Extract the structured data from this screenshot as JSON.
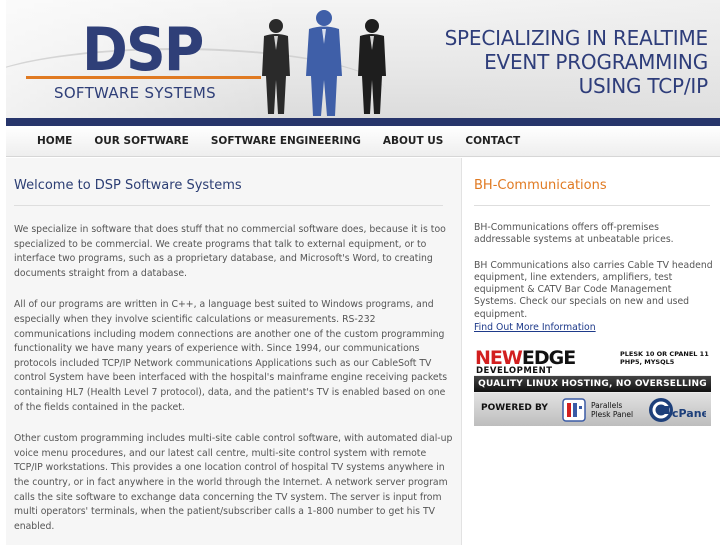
{
  "header": {
    "logo_main": "DSP",
    "logo_sub": "SOFTWARE SYSTEMS",
    "tagline": [
      "SPECIALIZING IN REALTIME",
      "EVENT PROGRAMMING",
      "USING TCP/IP"
    ]
  },
  "nav": {
    "items": [
      {
        "label": "HOME"
      },
      {
        "label": "OUR SOFTWARE"
      },
      {
        "label": "SOFTWARE ENGINEERING"
      },
      {
        "label": "ABOUT US"
      },
      {
        "label": "CONTACT"
      }
    ]
  },
  "main": {
    "title": "Welcome to DSP Software Systems",
    "paragraphs": [
      "We specialize in software that does stuff that no commercial software does, because it is too specialized to be commercial. We create programs that talk to external equipment, or to interface two programs, such as a proprietary database, and Microsoft's Word, to creating documents straight from a database.",
      "All of our programs are written in C++, a language best suited to Windows programs, and especially when they involve scientific calculations or measurements. RS-232 communications including modem connections are another one of the custom programming functionality we have many years of experience with. Since 1994, our communications protocols included TCP/IP Network communications Applications such as our CableSoft TV control System have been interfaced with the hospital's mainframe engine receiving packets containing HL7 (Health Level 7 protocol), data, and the patient's TV is enabled based on one of the fields contained in the packet.",
      "Other custom programming includes multi-site cable control software, with automated dial-up voice menu procedures, and our latest call centre, multi-site control system with remote TCP/IP workstations. This provides a one location control of hospital TV systems anywhere in the country, or in fact anywhere in the world through the Internet. A network server program calls the site software to exchange data concerning the TV system. The server is input from multi operators' terminals, when the patient/subscriber calls a 1-800 number to get his TV enabled."
    ]
  },
  "sidebar": {
    "title": "BH-Communications",
    "p1": "BH-Communications offers off-premises addressable systems at unbeatable prices.",
    "p2": "BH Communications also carries Cable TV headend equipment, line extenders, amplifiers, test equipment & CATV Bar Code Management Systems. Check our specials on new and used equipment.",
    "link": "Find Out More Information"
  },
  "ad": {
    "new": "NEW",
    "edge": "EDGE",
    "development": "DEVELOPMENT",
    "plesk_line1": "PLESK 10  OR CPANEL 11",
    "plesk_line2": "PHP5, MYSQL5",
    "band": "QUALITY LINUX HOSTING, NO OVERSELLING",
    "powered": "POWERED BY",
    "parallels_line1": "Parallels",
    "parallels_line2": "Plesk Panel",
    "cpanel": "cPanel"
  },
  "colors": {
    "brand_blue": "#2f3f78",
    "accent_orange": "#e07a22",
    "stripe": "#27356b",
    "link": "#1e3a8a"
  }
}
